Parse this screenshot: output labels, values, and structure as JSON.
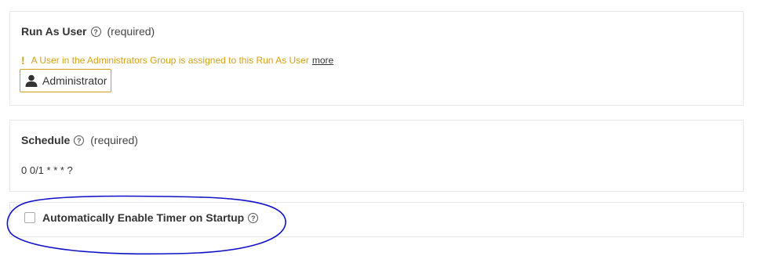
{
  "run_as": {
    "title": "Run As User",
    "required": "(required)",
    "warning_icon": "!",
    "warning_text": "A User in the Administrators Group is assigned to this Run As User",
    "warning_link": "more",
    "user_name": "Administrator",
    "user_icon": "user-icon"
  },
  "schedule": {
    "title": "Schedule",
    "required": "(required)",
    "cron": "0 0/1 * * * ?"
  },
  "timer": {
    "label": "Automatically Enable Timer on Startup",
    "checked": false
  },
  "help_glyph": "?",
  "colors": {
    "warning": "#d4a017",
    "annotation": "#1010c8",
    "border": "#e6e6e6"
  }
}
